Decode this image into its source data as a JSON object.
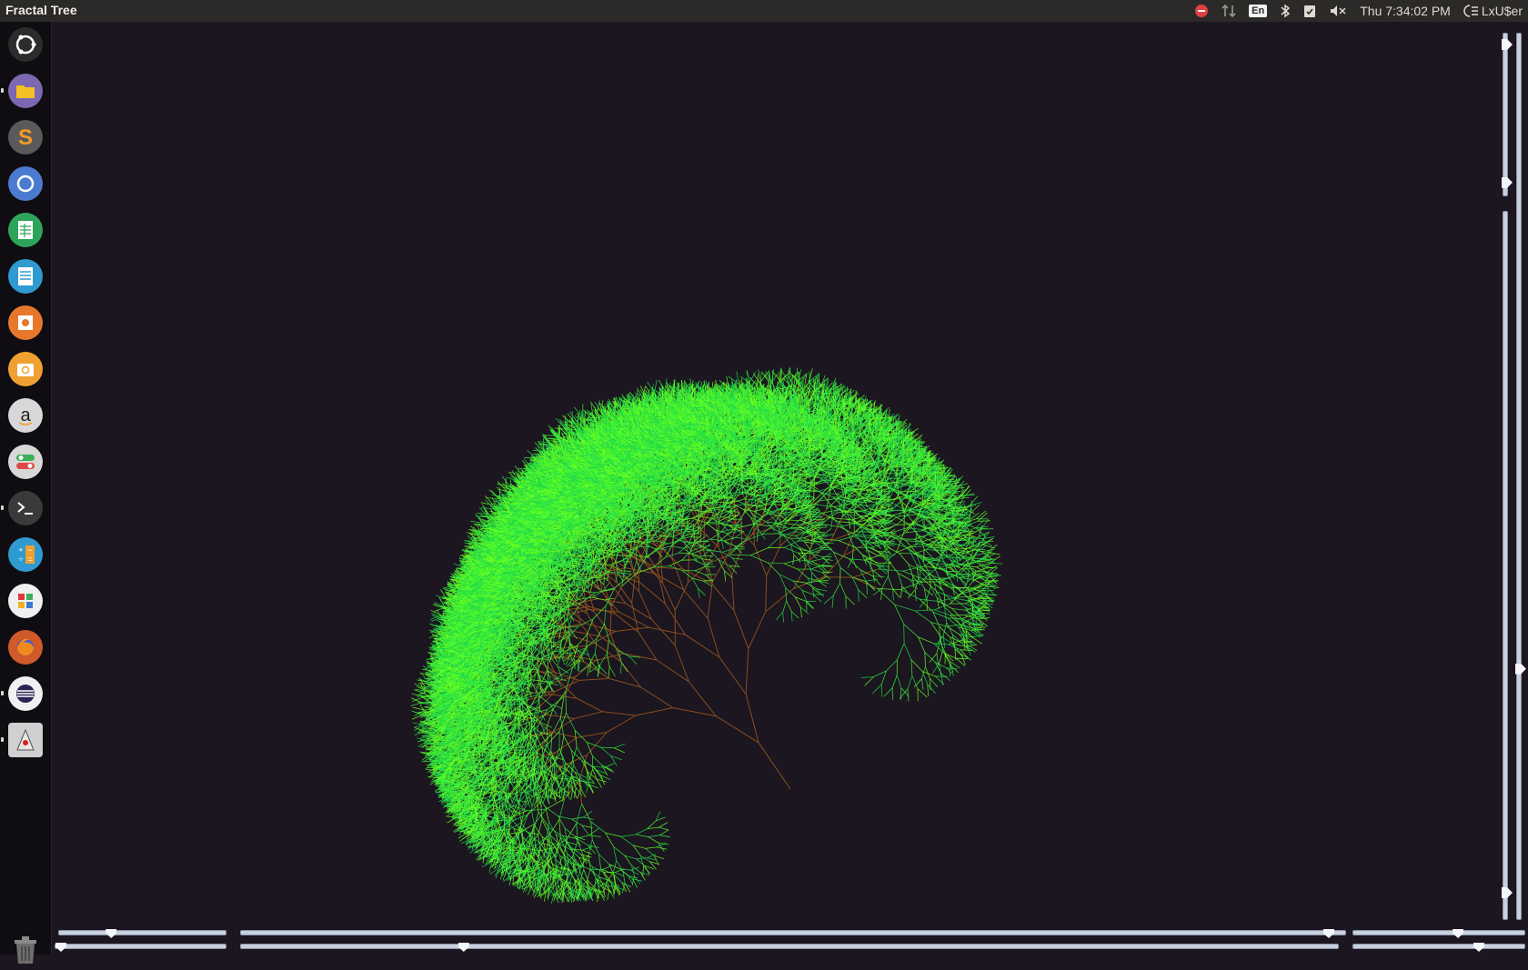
{
  "window": {
    "title": "Fractal Tree"
  },
  "indicators": {
    "keyboard": "En",
    "clock": "Thu 7:34:02 PM",
    "user": "LxU$er"
  },
  "launcher": {
    "items": [
      {
        "name": "ubuntu-dash-icon",
        "color": "#2c2c2c",
        "running": false
      },
      {
        "name": "files-icon",
        "color": "#7b68b0",
        "running": true
      },
      {
        "name": "sublime-text-icon",
        "color": "#5a5a5a",
        "running": false
      },
      {
        "name": "chromium-icon",
        "color": "#4a7bd0",
        "running": false
      },
      {
        "name": "calc-spreadsheet-icon",
        "color": "#2ea45a",
        "running": false
      },
      {
        "name": "writer-document-icon",
        "color": "#2e9ad0",
        "running": false
      },
      {
        "name": "impress-presentation-icon",
        "color": "#e8772b",
        "running": false
      },
      {
        "name": "software-center-icon",
        "color": "#f0a030",
        "running": false
      },
      {
        "name": "amazon-icon",
        "color": "#d8d8d8",
        "running": false
      },
      {
        "name": "system-settings-icon",
        "color": "#d8d8d8",
        "running": false
      },
      {
        "name": "terminal-icon",
        "color": "#3a3a3a",
        "running": true
      },
      {
        "name": "calculator-icon",
        "color": "#2e9ad0",
        "running": false
      },
      {
        "name": "apps-grid-icon",
        "color": "#f0f0f0",
        "running": false
      },
      {
        "name": "firefox-icon",
        "color": "#d05a2a",
        "running": false
      },
      {
        "name": "eclipse-icon",
        "color": "#f0f0f0",
        "running": true
      },
      {
        "name": "java-app-icon",
        "color": "#d0d0d0",
        "running": true
      }
    ],
    "trash": "trash-icon"
  },
  "sliders": {
    "bottom_row1": [
      0.3,
      0.99,
      0.62
    ],
    "bottom_row2": [
      0.0,
      0.2,
      0.75
    ],
    "right_top": 0.95,
    "right_col1": 0.97,
    "right_col2": 0.72
  },
  "tree": {
    "trunk_color": "#8a4e1e",
    "leaf_colors": [
      "#6aff1e",
      "#1ed84a",
      "#3cf03c"
    ],
    "depth": 14
  }
}
